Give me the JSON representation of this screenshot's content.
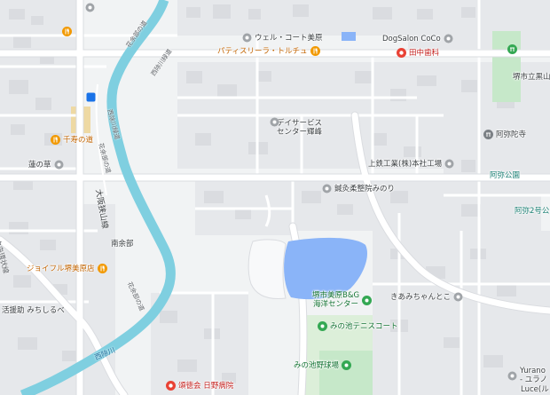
{
  "map": {
    "pois": [
      {
        "id": "well-court",
        "name": "ウェル・コート美原",
        "tone": "dark",
        "icon": "gray-pin"
      },
      {
        "id": "dogsalon",
        "name": "DogSalon CoCo",
        "tone": "dark",
        "icon": "gray-pin"
      },
      {
        "id": "patisserie",
        "name": "パティスリーラ・トルチュ",
        "tone": "orange",
        "icon": "fork-knife-icon"
      },
      {
        "id": "tanaka-dental",
        "name": "田中歯科",
        "tone": "red",
        "icon": "hospital-icon"
      },
      {
        "id": "kurozan-park",
        "name": "堺市立黒山",
        "tone": "dark",
        "icon": "none"
      },
      {
        "id": "day-service",
        "name": "デイサービス\nセンター輝峰",
        "tone": "dark",
        "icon": "gray-pin"
      },
      {
        "id": "amidaji",
        "name": "阿弥陀寺",
        "tone": "dark",
        "icon": "temple-icon"
      },
      {
        "id": "senju",
        "name": "千寿の道",
        "tone": "orange",
        "icon": "fork-knife-icon"
      },
      {
        "id": "hasunokusa",
        "name": "蓮の草",
        "tone": "dark",
        "icon": "gray-pin"
      },
      {
        "id": "joutetsu",
        "name": "上鉄工業(株)本社工場",
        "tone": "dark",
        "icon": "gray-pin"
      },
      {
        "id": "amida-park",
        "name": "阿弥公園",
        "tone": "teal",
        "icon": "none"
      },
      {
        "id": "seikotsu",
        "name": "鍼灸柔整院みのり",
        "tone": "dark",
        "icon": "gray-pin"
      },
      {
        "id": "amida2-park",
        "name": "阿弥2号公",
        "tone": "teal",
        "icon": "none"
      },
      {
        "id": "joyful",
        "name": "ジョイフル堺美原店",
        "tone": "orange",
        "icon": "fork-knife-icon"
      },
      {
        "id": "kaiyo-center",
        "name": "堺市美原B&G\n海洋センター",
        "tone": "green",
        "icon": "green-pin"
      },
      {
        "id": "kiamichan",
        "name": "きあみちゃんとこ",
        "tone": "dark",
        "icon": "gray-pin"
      },
      {
        "id": "katsuen",
        "name": "活援助 みちしるべ",
        "tone": "dark",
        "icon": "none"
      },
      {
        "id": "tennis",
        "name": "みの池テニスコート",
        "tone": "green",
        "icon": "green-pin"
      },
      {
        "id": "baseball",
        "name": "みの池野球場",
        "tone": "green",
        "icon": "green-pin"
      },
      {
        "id": "yurano",
        "name": "Yurano\n- ユラノ",
        "tone": "dark",
        "icon": "gray-pin"
      },
      {
        "id": "luce",
        "name": "Luce(ル",
        "tone": "dark",
        "icon": "none"
      },
      {
        "id": "hino-hospital",
        "name": "頌徳会 日野病院",
        "tone": "red",
        "icon": "hospital-icon"
      }
    ],
    "areas": [
      {
        "id": "minamiyobe",
        "name": "南余部"
      }
    ],
    "roads": [
      {
        "id": "nishiyoke-upper",
        "name": "花余部の道"
      },
      {
        "id": "nishiyoke-upper2",
        "name": "西除川緑道"
      },
      {
        "id": "nishiyoke-mid",
        "name": "西除川緑道"
      },
      {
        "id": "hanayobe-mid",
        "name": "花余部の道"
      },
      {
        "id": "osaka-sayama",
        "name": "大阪狭山線"
      },
      {
        "id": "hanayobe-low",
        "name": "花余部の道"
      },
      {
        "id": "chuo-kanjo",
        "name": "中央環状線"
      }
    ],
    "rivers": [
      {
        "id": "nishiyoke-river",
        "name": "西除川"
      }
    ],
    "colors": {
      "background": "#f1f3f4",
      "block": "#e8eaed",
      "building": "#dadce0",
      "road": "#ffffff",
      "road_outline": "#dadce0",
      "water": "#8ab4f8",
      "river": "#7fcfe0",
      "park": "#c6e8c9",
      "sports": "#dcefd9"
    }
  }
}
